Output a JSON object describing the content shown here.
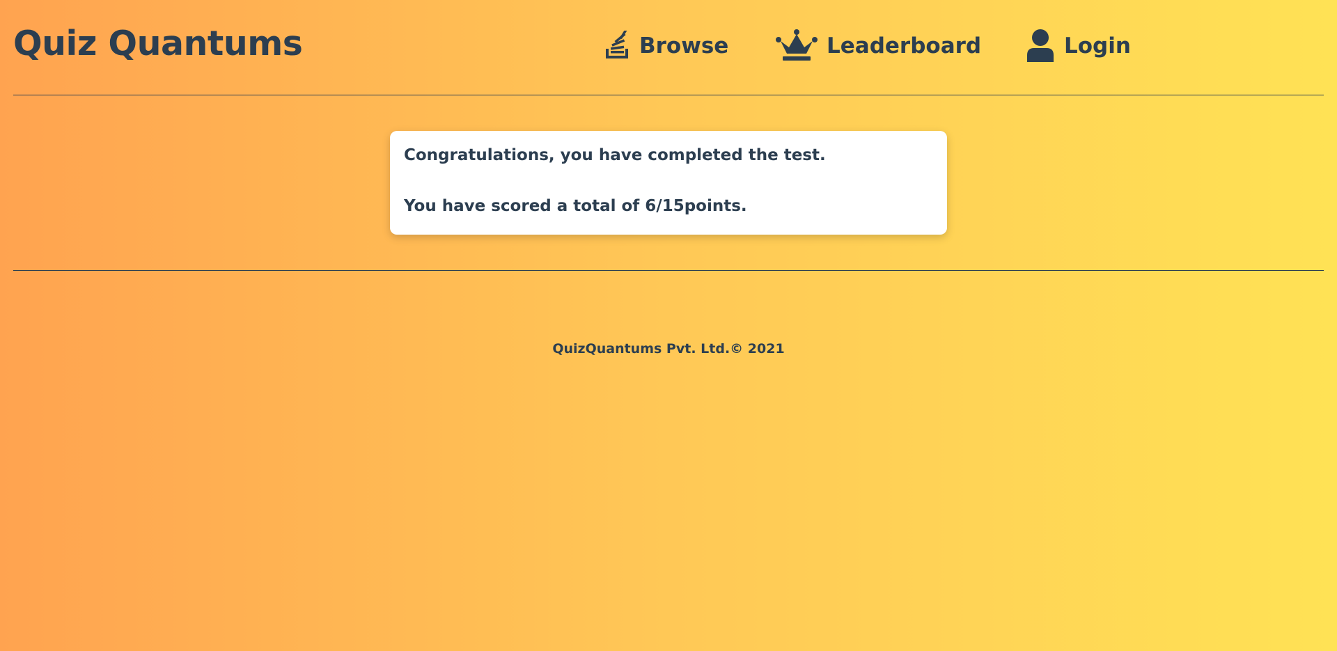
{
  "header": {
    "brand": "Quiz Quantums",
    "nav": [
      {
        "label": "Browse",
        "icon": "stack-exchange-icon"
      },
      {
        "label": "Leaderboard",
        "icon": "crown-icon"
      },
      {
        "label": "Login",
        "icon": "user-icon"
      }
    ]
  },
  "result": {
    "congrats": "Congratulations, you have completed the test.",
    "score_text": "You have scored a total of 6/15points."
  },
  "footer": {
    "text": "QuizQuantums Pvt. Ltd.© 2021"
  },
  "colors": {
    "text": "#2c3e50",
    "gradient_start": "#ffa350",
    "gradient_end": "#ffe255",
    "card": "#ffffff"
  }
}
